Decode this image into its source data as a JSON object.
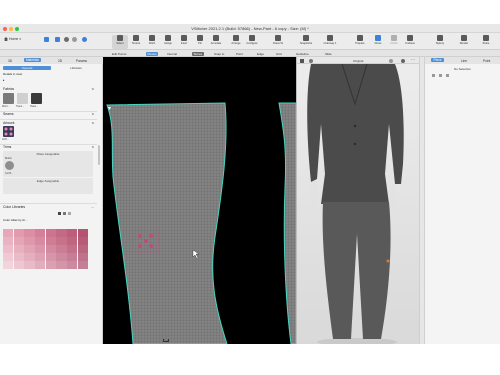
{
  "window": {
    "title": "VStitcher 2021.2.1 (Build: 57866) - New-Pant - 6 copy - Size: (M) *"
  },
  "toolbar": {
    "home_label": "Home",
    "tools": [
      {
        "label": "Select"
      },
      {
        "label": "Texture"
      },
      {
        "label": "Stitch"
      },
      {
        "label": "Assign"
      },
      {
        "label": "Insert"
      },
      {
        "label": "Pin"
      },
      {
        "label": "Annotate"
      },
      {
        "label": "Arrange"
      },
      {
        "label": "Configure"
      },
      {
        "label": "Dress W"
      },
      {
        "label": "Snapshots"
      },
      {
        "label": "Colorway 1"
      },
      {
        "label": "Prepare"
      },
      {
        "label": "Dress"
      },
      {
        "label": "Finish"
      },
      {
        "label": "Undress"
      },
      {
        "label": "Stylezy"
      },
      {
        "label": "Render"
      },
      {
        "label": "Share"
      }
    ]
  },
  "subbar": {
    "edit_points": "Edit Points",
    "pieces": "Pieces",
    "internal": "Internal",
    "stores": "Stores",
    "snap_to": "Snap to",
    "point": "Point",
    "edge": "Edge",
    "grid": "Grid",
    "guideline": "Guideline",
    "slide": "Slide",
    "original": "Original"
  },
  "left_panel": {
    "tabs": [
      "3D",
      "Materials",
      "2D",
      "Params"
    ],
    "active_tab": "Materials",
    "subtabs": [
      "Opened",
      "Libraries"
    ],
    "active_subtab": "Opened",
    "details_header": "Details in view",
    "search_placeholder": "Search",
    "filter_label": "Filter",
    "fabrics": {
      "title": "Fabrics",
      "items": [
        {
          "caption": "Wool ...",
          "color": "#7a7a7a"
        },
        {
          "caption": "Trans...",
          "color": "#cfcfcf"
        },
        {
          "caption": "Heavi...",
          "color": "#3a3a3a"
        }
      ]
    },
    "seams": {
      "title": "Seams"
    },
    "artwork": {
      "title": "Artwork",
      "item_caption": "ACP..."
    },
    "trims": {
      "title": "Trims"
    },
    "place_assignable": {
      "title": "Place Assignable",
      "item_caption": "Button",
      "sub_caption": "Cut B..."
    },
    "edge_assignable": {
      "title": "Edge Assignable"
    },
    "color_libraries": {
      "title": "Color Libraries",
      "selected": "Color Atlas by Ar..."
    },
    "swatch_colors": [
      "#e7a7b8",
      "#e29bae",
      "#dd8ea4",
      "#d5809a",
      "#cc7490",
      "#c46986",
      "#bc5e7c",
      "#b45472",
      "#e9b3c1",
      "#e4a6b6",
      "#de98ab",
      "#d78aa0",
      "#cf7d95",
      "#c7718b",
      "#bf6681",
      "#b75b77",
      "#ecbecb",
      "#e7b1c0",
      "#e1a4b5",
      "#da96aa",
      "#d3899f",
      "#cb7d95",
      "#c3718b",
      "#bb6681",
      "#efc9d4",
      "#eabcca",
      "#e4afbf",
      "#deA2b4",
      "#d795a9",
      "#cf899f",
      "#c77d95",
      "#bf728b",
      "#f2d4dd",
      "#edc8d3",
      "#e8bbc9",
      "#e2aebe",
      "#dba1b3",
      "#d495a9",
      "#cc899f",
      "#c47e95"
    ]
  },
  "viewport2d": {
    "piece_tag": "ATI",
    "fabric_color": "#7e7e7e",
    "outline_color": "#46d5c1",
    "trim_color": "#c24b7a"
  },
  "viewport3d": {
    "avatar_color": "#4a4a4a"
  },
  "right_panel": {
    "tabs": [
      "Piece",
      "Line",
      "Point"
    ],
    "active_tab": "Piece",
    "selection_status": "No Selection"
  }
}
